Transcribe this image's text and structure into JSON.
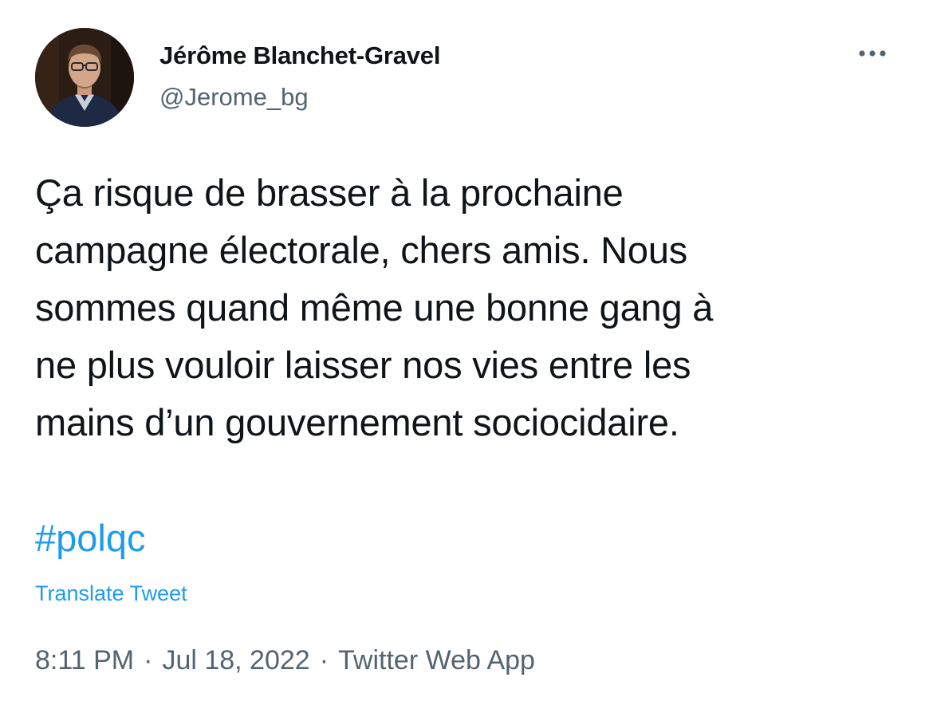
{
  "author": {
    "name": "Jérôme Blanchet-Gravel",
    "handle": "@Jerome_bg"
  },
  "icons": {
    "avatar": "profile-photo",
    "more": "more-horizontal-icon"
  },
  "tweet": {
    "text_lines": [
      "Ça risque de brasser à la prochaine",
      "campagne électorale, chers amis. Nous",
      "sommes quand même une bonne gang à",
      "ne plus vouloir laisser nos vies entre les",
      "mains d’un gouvernement sociocidaire."
    ],
    "hashtag": "#polqc",
    "translate_label": "Translate Tweet"
  },
  "meta": {
    "time": "8:11 PM",
    "separator": "·",
    "date": "Jul 18, 2022",
    "source": "Twitter Web App"
  },
  "colors": {
    "text": "#0f1419",
    "secondary": "#536471",
    "link": "#1d9bf0"
  }
}
